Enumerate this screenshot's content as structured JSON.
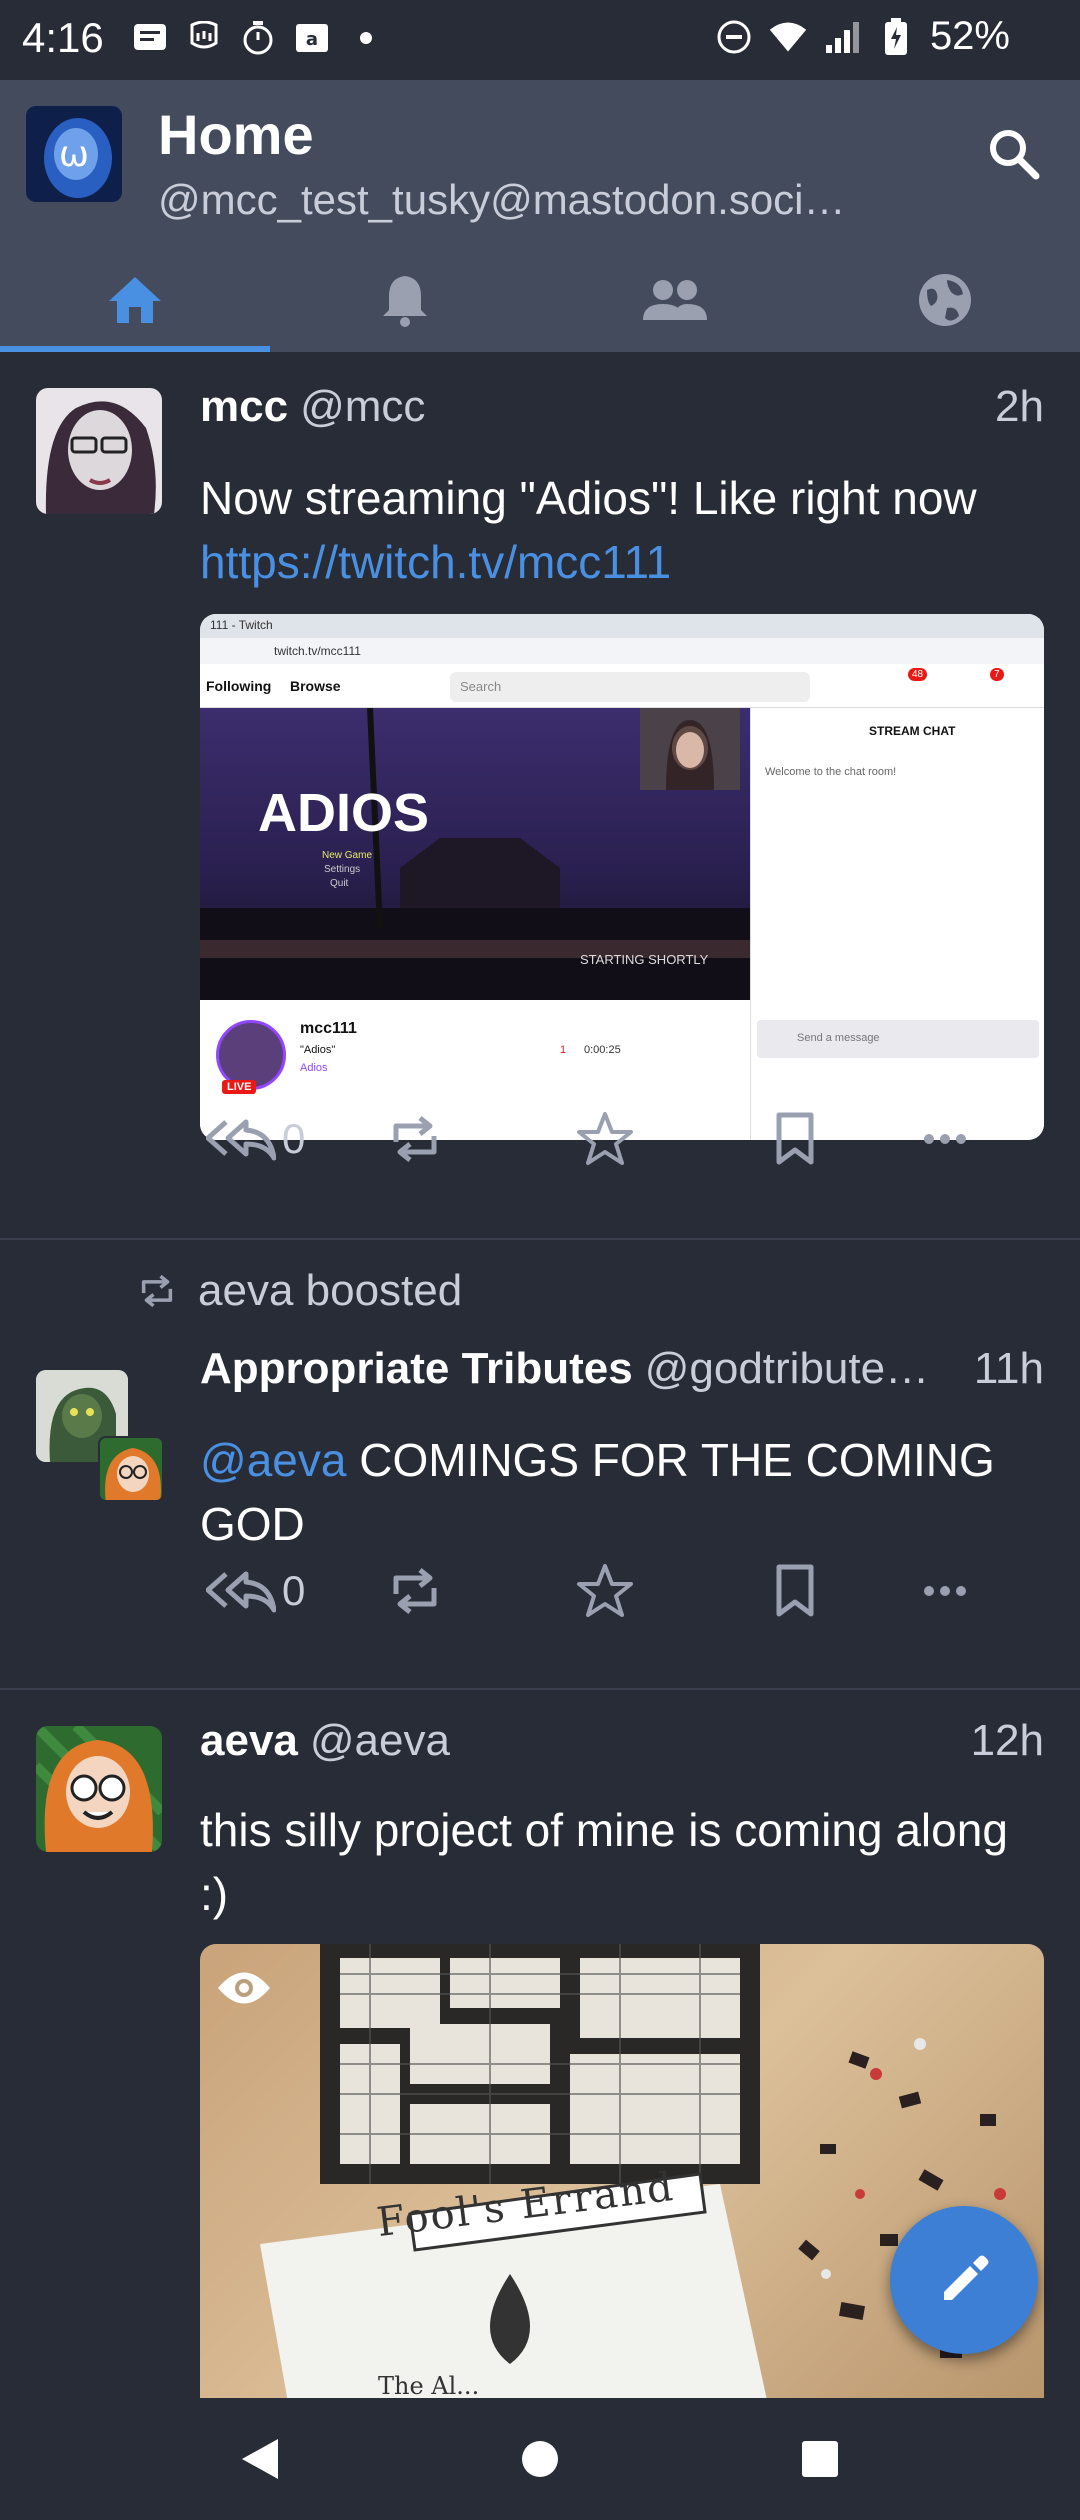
{
  "status_bar": {
    "time": "4:16",
    "battery": "52%"
  },
  "toolbar": {
    "title": "Home",
    "account": "@mcc_test_tusky@mastodon.soci…"
  },
  "tabs": [
    {
      "name": "home",
      "icon": "home-icon",
      "active": true
    },
    {
      "name": "notifications",
      "icon": "bell-icon",
      "active": false
    },
    {
      "name": "local",
      "icon": "people-icon",
      "active": false
    },
    {
      "name": "federated",
      "icon": "globe-icon",
      "active": false
    }
  ],
  "posts": [
    {
      "display_name": "mcc",
      "handle": "@mcc",
      "time": "2h",
      "text": "Now streaming \"Adios\"! Like right now",
      "link": "https://twitch.tv/mcc111",
      "replies": "0",
      "media": {
        "tab_title": "111 - Twitch",
        "url_bar": "twitch.tv/mcc111",
        "nav_following": "Following",
        "nav_browse": "Browse",
        "search_placeholder": "Search",
        "badge_a": "48",
        "badge_b": "7",
        "game_title": "ADIOS",
        "menu_1": "New Game",
        "menu_2": "Settings",
        "menu_3": "Quit",
        "starting": "STARTING SHORTLY",
        "chat_title": "STREAM CHAT",
        "chat_welcome": "Welcome to the chat room!",
        "send_placeholder": "Send a message",
        "channel": "mcc111",
        "stream_title": "\"Adios\"",
        "category": "Adios",
        "live": "LIVE",
        "viewers": "1",
        "uptime": "0:00:25"
      }
    },
    {
      "boosted_by": "aeva boosted",
      "display_name": "Appropriate Tributes",
      "handle": "@godtribute…",
      "time": "11h",
      "mention": "@aeva",
      "text": " COMINGS FOR THE COMING GOD",
      "replies": "0"
    },
    {
      "display_name": "aeva",
      "handle": "@aeva",
      "time": "12h",
      "text": "this silly project of mine is coming along :)",
      "media": {
        "card_text": "Fool's Errand",
        "card_sub": "The Al..."
      }
    }
  ],
  "colors": {
    "background": "#282c37",
    "toolbar": "#444b5d",
    "accent": "#4a90e2",
    "secondary_text": "#c9cdd9"
  }
}
